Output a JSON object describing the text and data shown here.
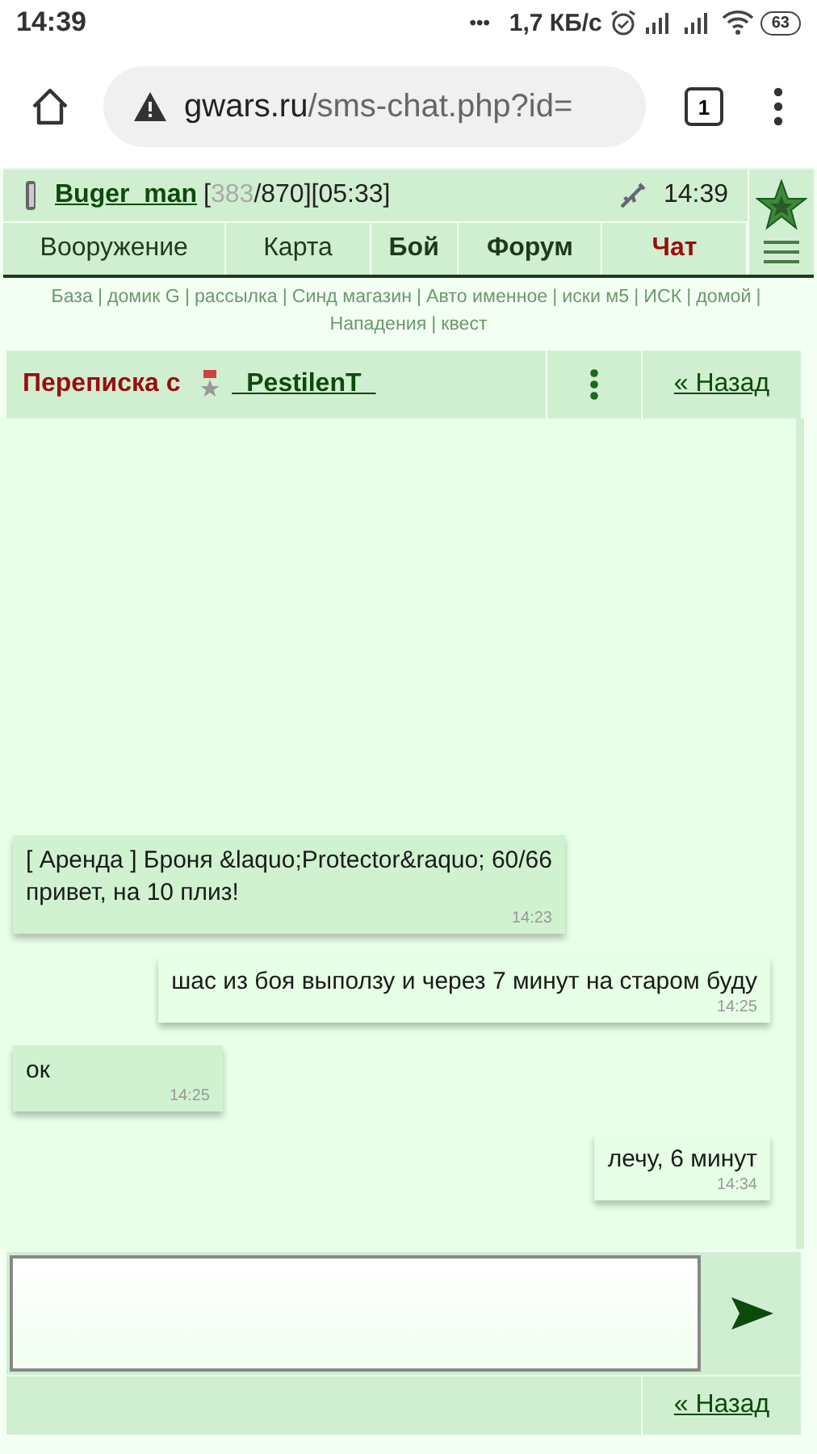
{
  "status_bar": {
    "time": "14:39",
    "more": "•••",
    "speed": "1,7 КБ/с",
    "battery": "63"
  },
  "browser": {
    "url_host": "gwars.ru",
    "url_path": "/sms-chat.php?id=",
    "tab_count": "1"
  },
  "player": {
    "name": "Buger_man",
    "open": "[",
    "hp": "383",
    "rest": "/870][05:33]",
    "time": "14:39"
  },
  "nav": [
    {
      "label": "Вооружение",
      "kind": "normal"
    },
    {
      "label": "Карта",
      "kind": "normal"
    },
    {
      "label": "Бой",
      "kind": "bold"
    },
    {
      "label": "Форум",
      "kind": "bold"
    },
    {
      "label": "Чат",
      "kind": "active"
    }
  ],
  "links": [
    {
      "label": "База",
      "sep": "|"
    },
    {
      "label": "домик G",
      "sep": "|"
    },
    {
      "label": "рассылка",
      "sep": "|"
    },
    {
      "label": "Синд магазин",
      "sep": "|"
    },
    {
      "label": "Авто именное",
      "sep": "|"
    },
    {
      "label": "иски м5",
      "sep": "|"
    },
    {
      "label": "ИСК",
      "sep": "|"
    },
    {
      "label": "домой",
      "sep": "|"
    },
    {
      "label": "Нападения",
      "sep": "|"
    },
    {
      "label": "квест"
    }
  ],
  "chat_header": {
    "title": "Переписка с",
    "partner": "_PestilenT_",
    "back": "« Назад"
  },
  "messages": [
    {
      "outgoing": false,
      "lines": [
        "[ Аренда ] Броня &laquo;Protector&raquo; 60/66",
        "привет, на 10 плиз!"
      ],
      "time": "14:23"
    },
    {
      "outgoing": true,
      "lines": [
        "шас из боя выползу и через 7 минут на старом буду"
      ],
      "time": "14:25"
    },
    {
      "outgoing": false,
      "lines": [
        "ок"
      ],
      "time": "14:25"
    },
    {
      "outgoing": true,
      "lines": [
        "лечу, 6 минут"
      ],
      "time": "14:34"
    }
  ],
  "footer": {
    "back": "« Назад"
  }
}
